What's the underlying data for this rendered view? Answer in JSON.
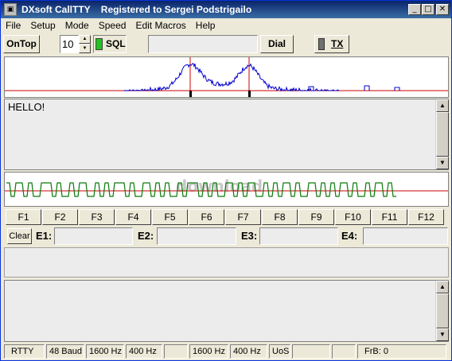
{
  "window": {
    "title": "DXsoft CallTTY    Registered to Sergei Podstrigailo",
    "minimize": "_",
    "maximize": "□",
    "close": "✕"
  },
  "menu": [
    "File",
    "Setup",
    "Mode",
    "Speed",
    "Edit Macros",
    "Help"
  ],
  "toolbar": {
    "ontop_label": "OnTop",
    "speed_value": "10",
    "sql_label": "SQL",
    "sql_color": "#22c322",
    "field_value": "",
    "dial_label": "Dial",
    "tx_label": "TX"
  },
  "rx": {
    "text": "HELLO!"
  },
  "fkeys": [
    "F1",
    "F2",
    "F3",
    "F4",
    "F5",
    "F6",
    "F7",
    "F8",
    "F9",
    "F10",
    "F11",
    "F12"
  ],
  "erow": {
    "clear_label": "Clear",
    "e1": "E1:",
    "e2": "E2:",
    "e3": "E3:",
    "e4": "E4:"
  },
  "watermark": "download",
  "status": {
    "mode": "RTTY",
    "baud": "48 Baud",
    "freq1": "1600 Hz",
    "shift1": "400 Hz",
    "freq2": "1600 Hz",
    "shift2": "400 Hz",
    "uos": "UoS",
    "frb": "FrB: 0"
  },
  "colors": {
    "spectrum_trace": "#0000cc",
    "marker": "#cc0000",
    "scope_trace": "#0a7a0a",
    "scope_center": "#cc0000"
  }
}
